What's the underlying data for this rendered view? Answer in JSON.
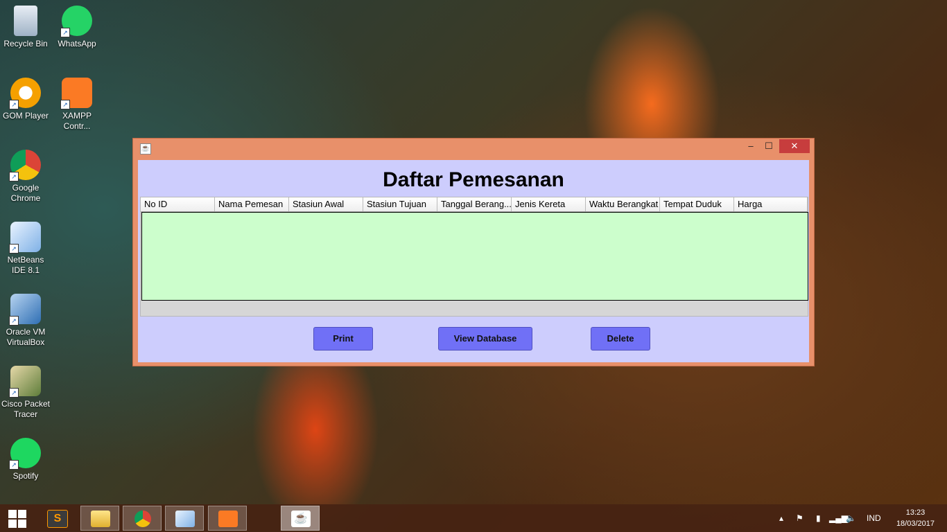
{
  "desktop": {
    "icons": [
      {
        "label": "Recycle Bin"
      },
      {
        "label": "WhatsApp"
      },
      {
        "label": "GOM Player"
      },
      {
        "label": "XAMPP Contr..."
      },
      {
        "label": "Google Chrome"
      },
      {
        "label": "NetBeans IDE 8.1"
      },
      {
        "label": "Oracle VM VirtualBox"
      },
      {
        "label": "Cisco Packet Tracer"
      },
      {
        "label": "Spotify"
      }
    ]
  },
  "window": {
    "title": "",
    "icon": "java-icon",
    "minimize": "–",
    "maximize": "☐",
    "close": "✕",
    "heading": "Daftar Pemesanan",
    "columns": [
      "No ID",
      "Nama Pemesan",
      "Stasiun Awal",
      "Stasiun Tujuan",
      "Tanggal Berang...",
      "Jenis Kereta",
      "Waktu Berangkat",
      "Tempat Duduk",
      "Harga"
    ],
    "rows": [],
    "buttons": {
      "print": "Print",
      "view_database": "View Database",
      "delete": "Delete"
    },
    "colors": {
      "frame": "#e8906a",
      "panel": "#cdcdfd",
      "table_body": "#ccfecc",
      "button": "#7070f6"
    }
  },
  "taskbar": {
    "apps": [
      "start-icon",
      "sublime-text-icon",
      "file-explorer-icon",
      "chrome-icon",
      "netbeans-icon",
      "xampp-icon",
      "java-icon"
    ],
    "language": "IND",
    "time": "13:23",
    "date": "18/03/2017"
  }
}
